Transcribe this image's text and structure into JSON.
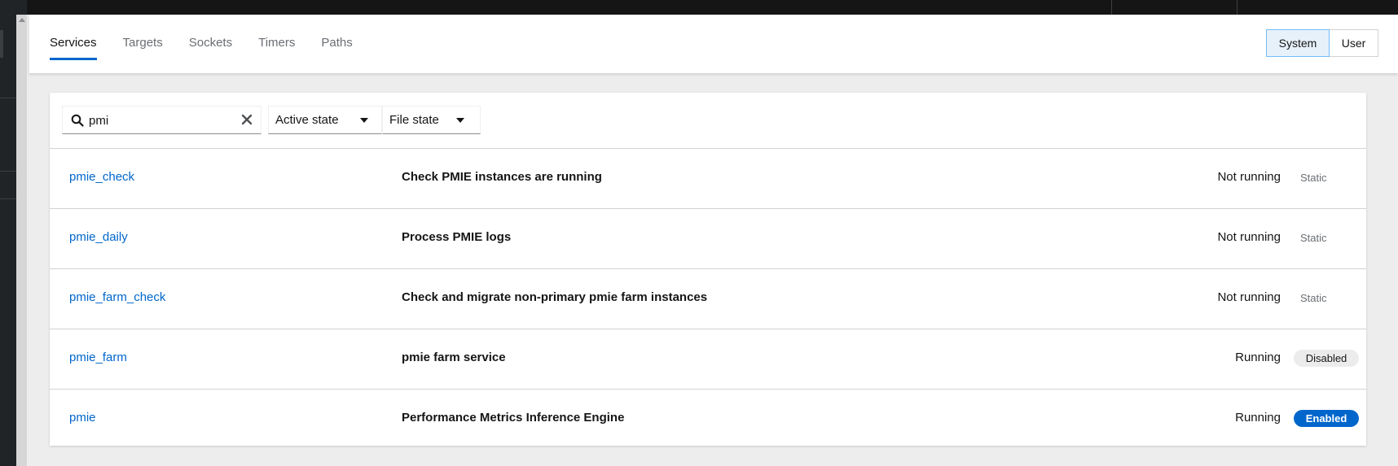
{
  "tabs": [
    {
      "label": "Services",
      "active": true
    },
    {
      "label": "Targets",
      "active": false
    },
    {
      "label": "Sockets",
      "active": false
    },
    {
      "label": "Timers",
      "active": false
    },
    {
      "label": "Paths",
      "active": false
    }
  ],
  "scope_toggle": {
    "system_label": "System",
    "user_label": "User",
    "selected": "System"
  },
  "filters": {
    "search_value": "pmi",
    "active_state_label": "Active state",
    "file_state_label": "File state"
  },
  "services": [
    {
      "name": "pmie_check",
      "description": "Check PMIE instances are running",
      "state": "Not running",
      "file_state": "Static"
    },
    {
      "name": "pmie_daily",
      "description": "Process PMIE logs",
      "state": "Not running",
      "file_state": "Static"
    },
    {
      "name": "pmie_farm_check",
      "description": "Check and migrate non-primary pmie farm instances",
      "state": "Not running",
      "file_state": "Static"
    },
    {
      "name": "pmie_farm",
      "description": "pmie farm service",
      "state": "Running",
      "file_state": "Disabled"
    },
    {
      "name": "pmie",
      "description": "Performance Metrics Inference Engine",
      "state": "Running",
      "file_state": "Enabled"
    }
  ],
  "colors": {
    "accent": "#0066cc",
    "enabled_badge": "#0066cc",
    "disabled_badge": "#ececec"
  }
}
